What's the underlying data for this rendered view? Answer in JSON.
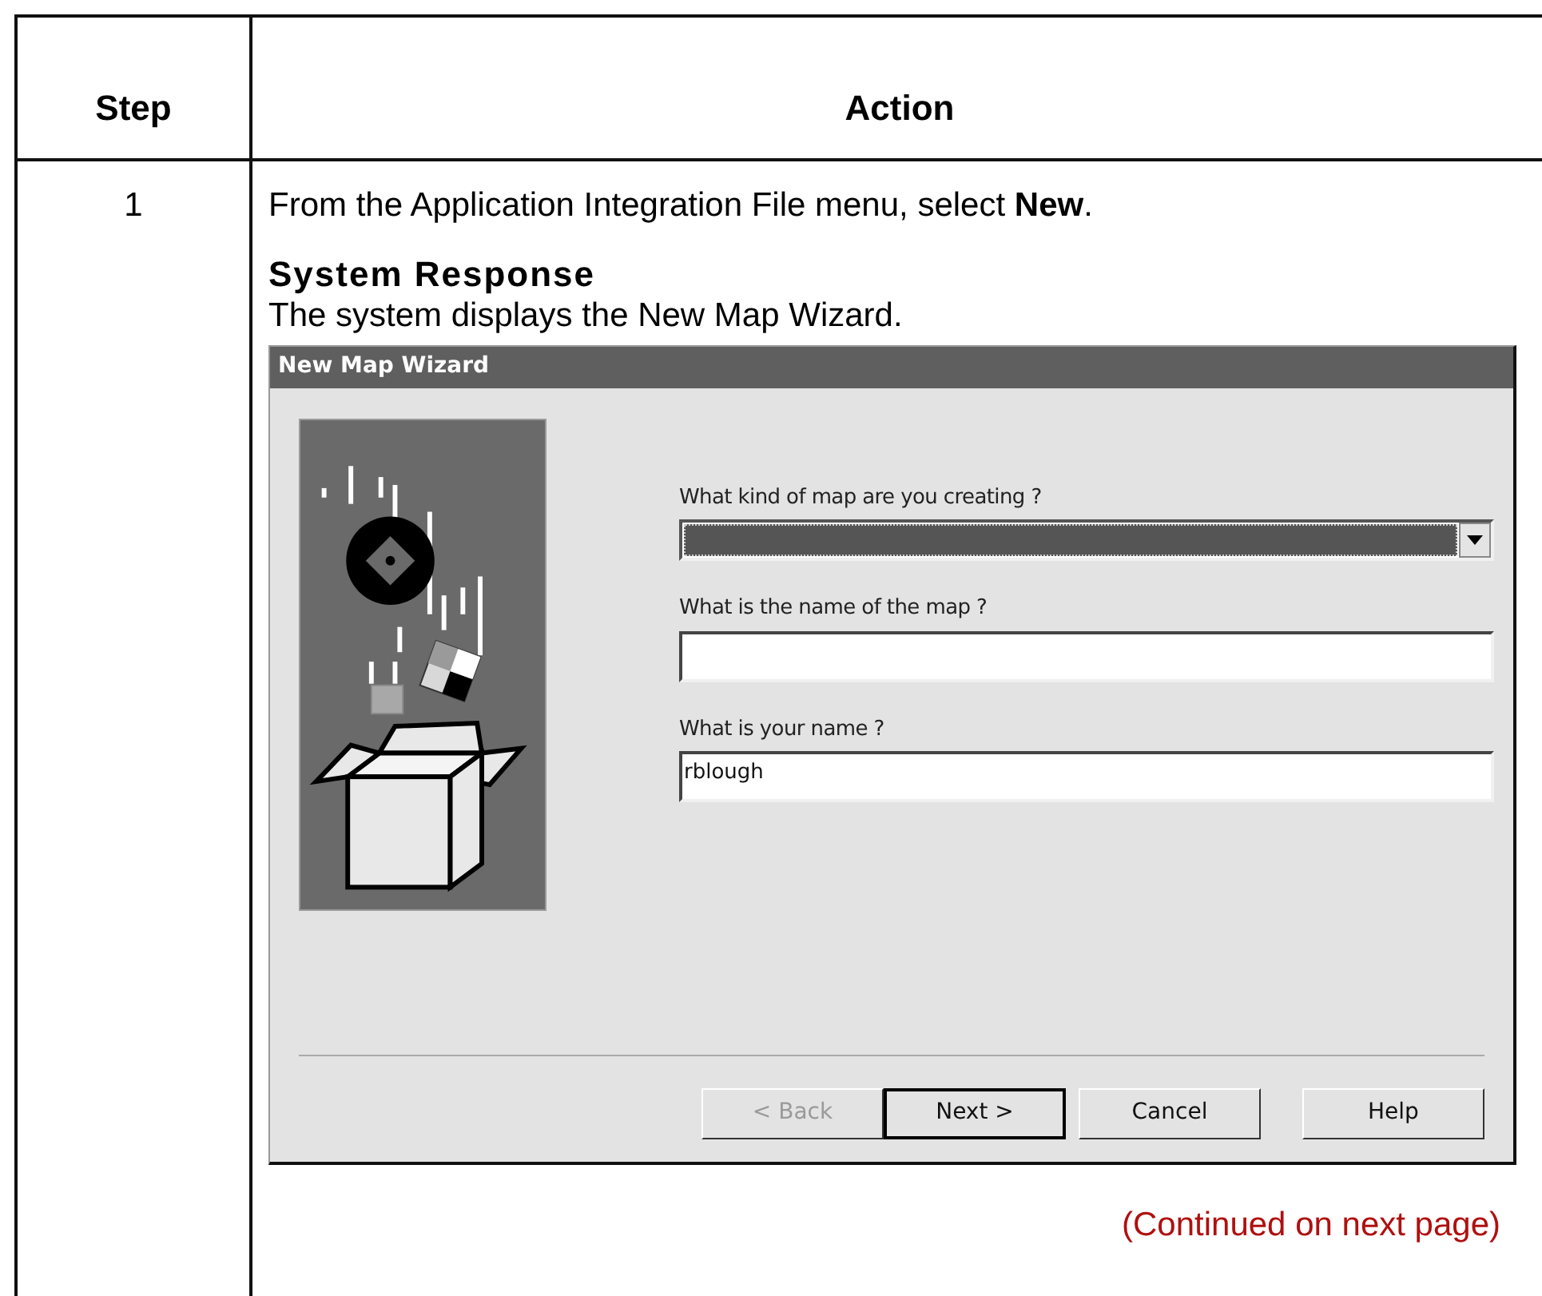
{
  "table": {
    "columns": [
      "Step",
      "Action"
    ],
    "rows": [
      {
        "step": "1",
        "instruction": "From the Application Integration File menu, select **New**.",
        "response_heading": "System Response",
        "response_text": "The system displays the New Map Wizard.",
        "dialog": {
          "title": "New Map Wizard",
          "fields": [
            {
              "kind": "dropdown",
              "label": "What kind of map are you creating ?",
              "focused": true
            },
            {
              "kind": "text",
              "label": "What is the name of the map ?",
              "focused": false
            },
            {
              "kind": "text",
              "label": "What is your name ?",
              "value": "rblough",
              "focused": false
            }
          ],
          "buttons": [
            {
              "label": "< Back",
              "disabled": true,
              "default": false
            },
            {
              "label": "Next >",
              "disabled": false,
              "default": true
            },
            {
              "label": "Cancel",
              "disabled": false,
              "default": false
            },
            {
              "label": "Help",
              "disabled": false,
              "default": false
            }
          ]
        }
      }
    ]
  },
  "continued_note": "(Continued on next page)"
}
